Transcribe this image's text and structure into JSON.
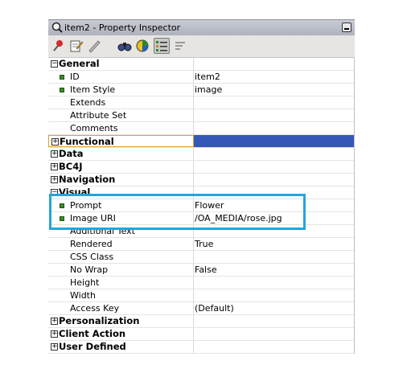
{
  "window": {
    "title": "item2 - Property Inspector"
  },
  "toolbar": {
    "icons": [
      "pin-icon",
      "edit-icon",
      "pencil-icon",
      "binoculars-icon",
      "color-wheel-icon",
      "group-by-category-icon",
      "sort-icon"
    ]
  },
  "rows": [
    {
      "type": "category",
      "expanded": true,
      "label": "General"
    },
    {
      "type": "property",
      "bullet": true,
      "label": "ID",
      "value": "item2"
    },
    {
      "type": "property",
      "bullet": true,
      "label": "Item Style",
      "value": "image"
    },
    {
      "type": "property",
      "bullet": false,
      "label": "Extends",
      "value": ""
    },
    {
      "type": "property",
      "bullet": false,
      "label": "Attribute Set",
      "value": ""
    },
    {
      "type": "property",
      "bullet": false,
      "label": "Comments",
      "value": ""
    },
    {
      "type": "category",
      "expanded": false,
      "label": "Functional",
      "selected": true
    },
    {
      "type": "category",
      "expanded": false,
      "label": "Data"
    },
    {
      "type": "category",
      "expanded": false,
      "label": "BC4J"
    },
    {
      "type": "category",
      "expanded": false,
      "label": "Navigation"
    },
    {
      "type": "category",
      "expanded": true,
      "label": "Visual"
    },
    {
      "type": "property",
      "bullet": true,
      "label": "Prompt",
      "value": "Flower"
    },
    {
      "type": "property",
      "bullet": true,
      "label": "Image URI",
      "value": "/OA_MEDIA/rose.jpg"
    },
    {
      "type": "property",
      "bullet": false,
      "label": "Additional Text",
      "value": ""
    },
    {
      "type": "property",
      "bullet": false,
      "label": "Rendered",
      "value": "True"
    },
    {
      "type": "property",
      "bullet": false,
      "label": "CSS Class",
      "value": ""
    },
    {
      "type": "property",
      "bullet": false,
      "label": "No Wrap",
      "value": "False"
    },
    {
      "type": "property",
      "bullet": false,
      "label": "Height",
      "value": ""
    },
    {
      "type": "property",
      "bullet": false,
      "label": "Width",
      "value": ""
    },
    {
      "type": "property",
      "bullet": false,
      "label": "Access Key",
      "value": "(Default)"
    },
    {
      "type": "category",
      "expanded": false,
      "label": "Personalization"
    },
    {
      "type": "category",
      "expanded": false,
      "label": "Client Action"
    },
    {
      "type": "category",
      "expanded": false,
      "label": "User Defined"
    }
  ],
  "colors": {
    "selection": "#3557b7",
    "highlight": "#23a5dc",
    "bullet": "#3b8a2a"
  }
}
